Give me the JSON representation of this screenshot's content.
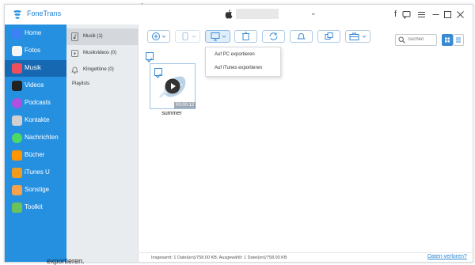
{
  "caption": {
    "top": "·",
    "bottom": "exportieren."
  },
  "app": {
    "title": "FoneTrans"
  },
  "titlebar": {
    "icons": [
      "facebook-icon",
      "feedback-icon",
      "menu-icon",
      "minimize-icon",
      "maximize-icon",
      "close-icon"
    ]
  },
  "sidebar": {
    "items": [
      {
        "label": "Home",
        "icon": "home-icon",
        "color": "#3b82f6"
      },
      {
        "label": "Fotos",
        "icon": "photos-icon",
        "color": "#f5f5f5"
      },
      {
        "label": "Musik",
        "icon": "music-icon",
        "color": "#ef4f5c"
      },
      {
        "label": "Videos",
        "icon": "tv-icon",
        "color": "#222222"
      },
      {
        "label": "Podcasts",
        "icon": "podcasts-icon",
        "color": "#b050e0"
      },
      {
        "label": "Kontakte",
        "icon": "contacts-icon",
        "color": "#d0d0d0"
      },
      {
        "label": "Nachrichten",
        "icon": "messages-icon",
        "color": "#4cd964"
      },
      {
        "label": "Bücher",
        "icon": "books-icon",
        "color": "#ff9500"
      },
      {
        "label": "iTunes U",
        "icon": "itunes-u-icon",
        "color": "#f09c1f"
      },
      {
        "label": "Sonstige",
        "icon": "other-icon",
        "color": "#f7a24b"
      },
      {
        "label": "Toolkit",
        "icon": "toolkit-icon",
        "color": "#6ac259"
      }
    ]
  },
  "subpanel": {
    "items": [
      {
        "label": "Musik (1)",
        "icon": "music-note-icon"
      },
      {
        "label": "Musikvideos (0)",
        "icon": "music-video-icon"
      },
      {
        "label": "Klingeltöne (0)",
        "icon": "bell-icon"
      }
    ],
    "playlists_label": "Playlists"
  },
  "search": {
    "placeholder": "Suchen"
  },
  "media": {
    "duration": "00:00:12",
    "name": "summer"
  },
  "dropdown": {
    "items": [
      "Auf PC exportieren",
      "Auf iTunes exportieren"
    ]
  },
  "status": {
    "text": "Insgesamt: 1 Datei(en)/758.00 KB; Ausgewählt: 1 Datei(en)/758.00 KB",
    "link": "Daten verloren?"
  },
  "colors": {
    "accent": "#2690e0",
    "active_nav": "#1768b3"
  }
}
